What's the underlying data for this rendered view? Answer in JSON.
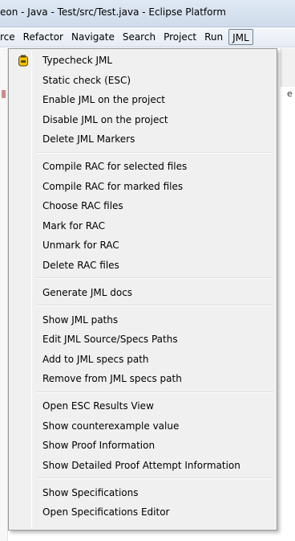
{
  "window": {
    "title": "eon - Java - Test/src/Test.java - Eclipse Platform"
  },
  "menubar": {
    "items": [
      "rce",
      "Refactor",
      "Navigate",
      "Search",
      "Project",
      "Run",
      "JML"
    ],
    "active": "JML"
  },
  "menu": {
    "groups": [
      {
        "items": [
          {
            "label": "Typecheck JML",
            "icon": "jml-typecheck-icon"
          },
          {
            "label": "Static check (ESC)"
          },
          {
            "label": "Enable JML on the project"
          },
          {
            "label": "Disable JML on the project"
          },
          {
            "label": "Delete JML Markers"
          }
        ]
      },
      {
        "items": [
          {
            "label": "Compile RAC for selected files"
          },
          {
            "label": "Compile RAC for marked files"
          },
          {
            "label": "Choose RAC files"
          },
          {
            "label": "Mark for RAC"
          },
          {
            "label": "Unmark for RAC"
          },
          {
            "label": "Delete RAC files"
          }
        ]
      },
      {
        "items": [
          {
            "label": "Generate JML docs"
          }
        ]
      },
      {
        "items": [
          {
            "label": "Show JML paths"
          },
          {
            "label": "Edit JML Source/Specs Paths"
          },
          {
            "label": "Add to JML specs path"
          },
          {
            "label": "Remove from JML specs path"
          }
        ]
      },
      {
        "items": [
          {
            "label": "Open ESC Results View"
          },
          {
            "label": "Show counterexample value"
          },
          {
            "label": "Show Proof Information"
          },
          {
            "label": "Show Detailed Proof Attempt Information"
          }
        ]
      },
      {
        "items": [
          {
            "label": "Show Specifications"
          },
          {
            "label": "Open Specifications Editor"
          }
        ]
      }
    ]
  },
  "colors": {
    "menu_bg": "#f0f0f0",
    "menu_border": "#979797",
    "icon_yellow": "#f2c200",
    "icon_dark": "#5a4a10"
  }
}
